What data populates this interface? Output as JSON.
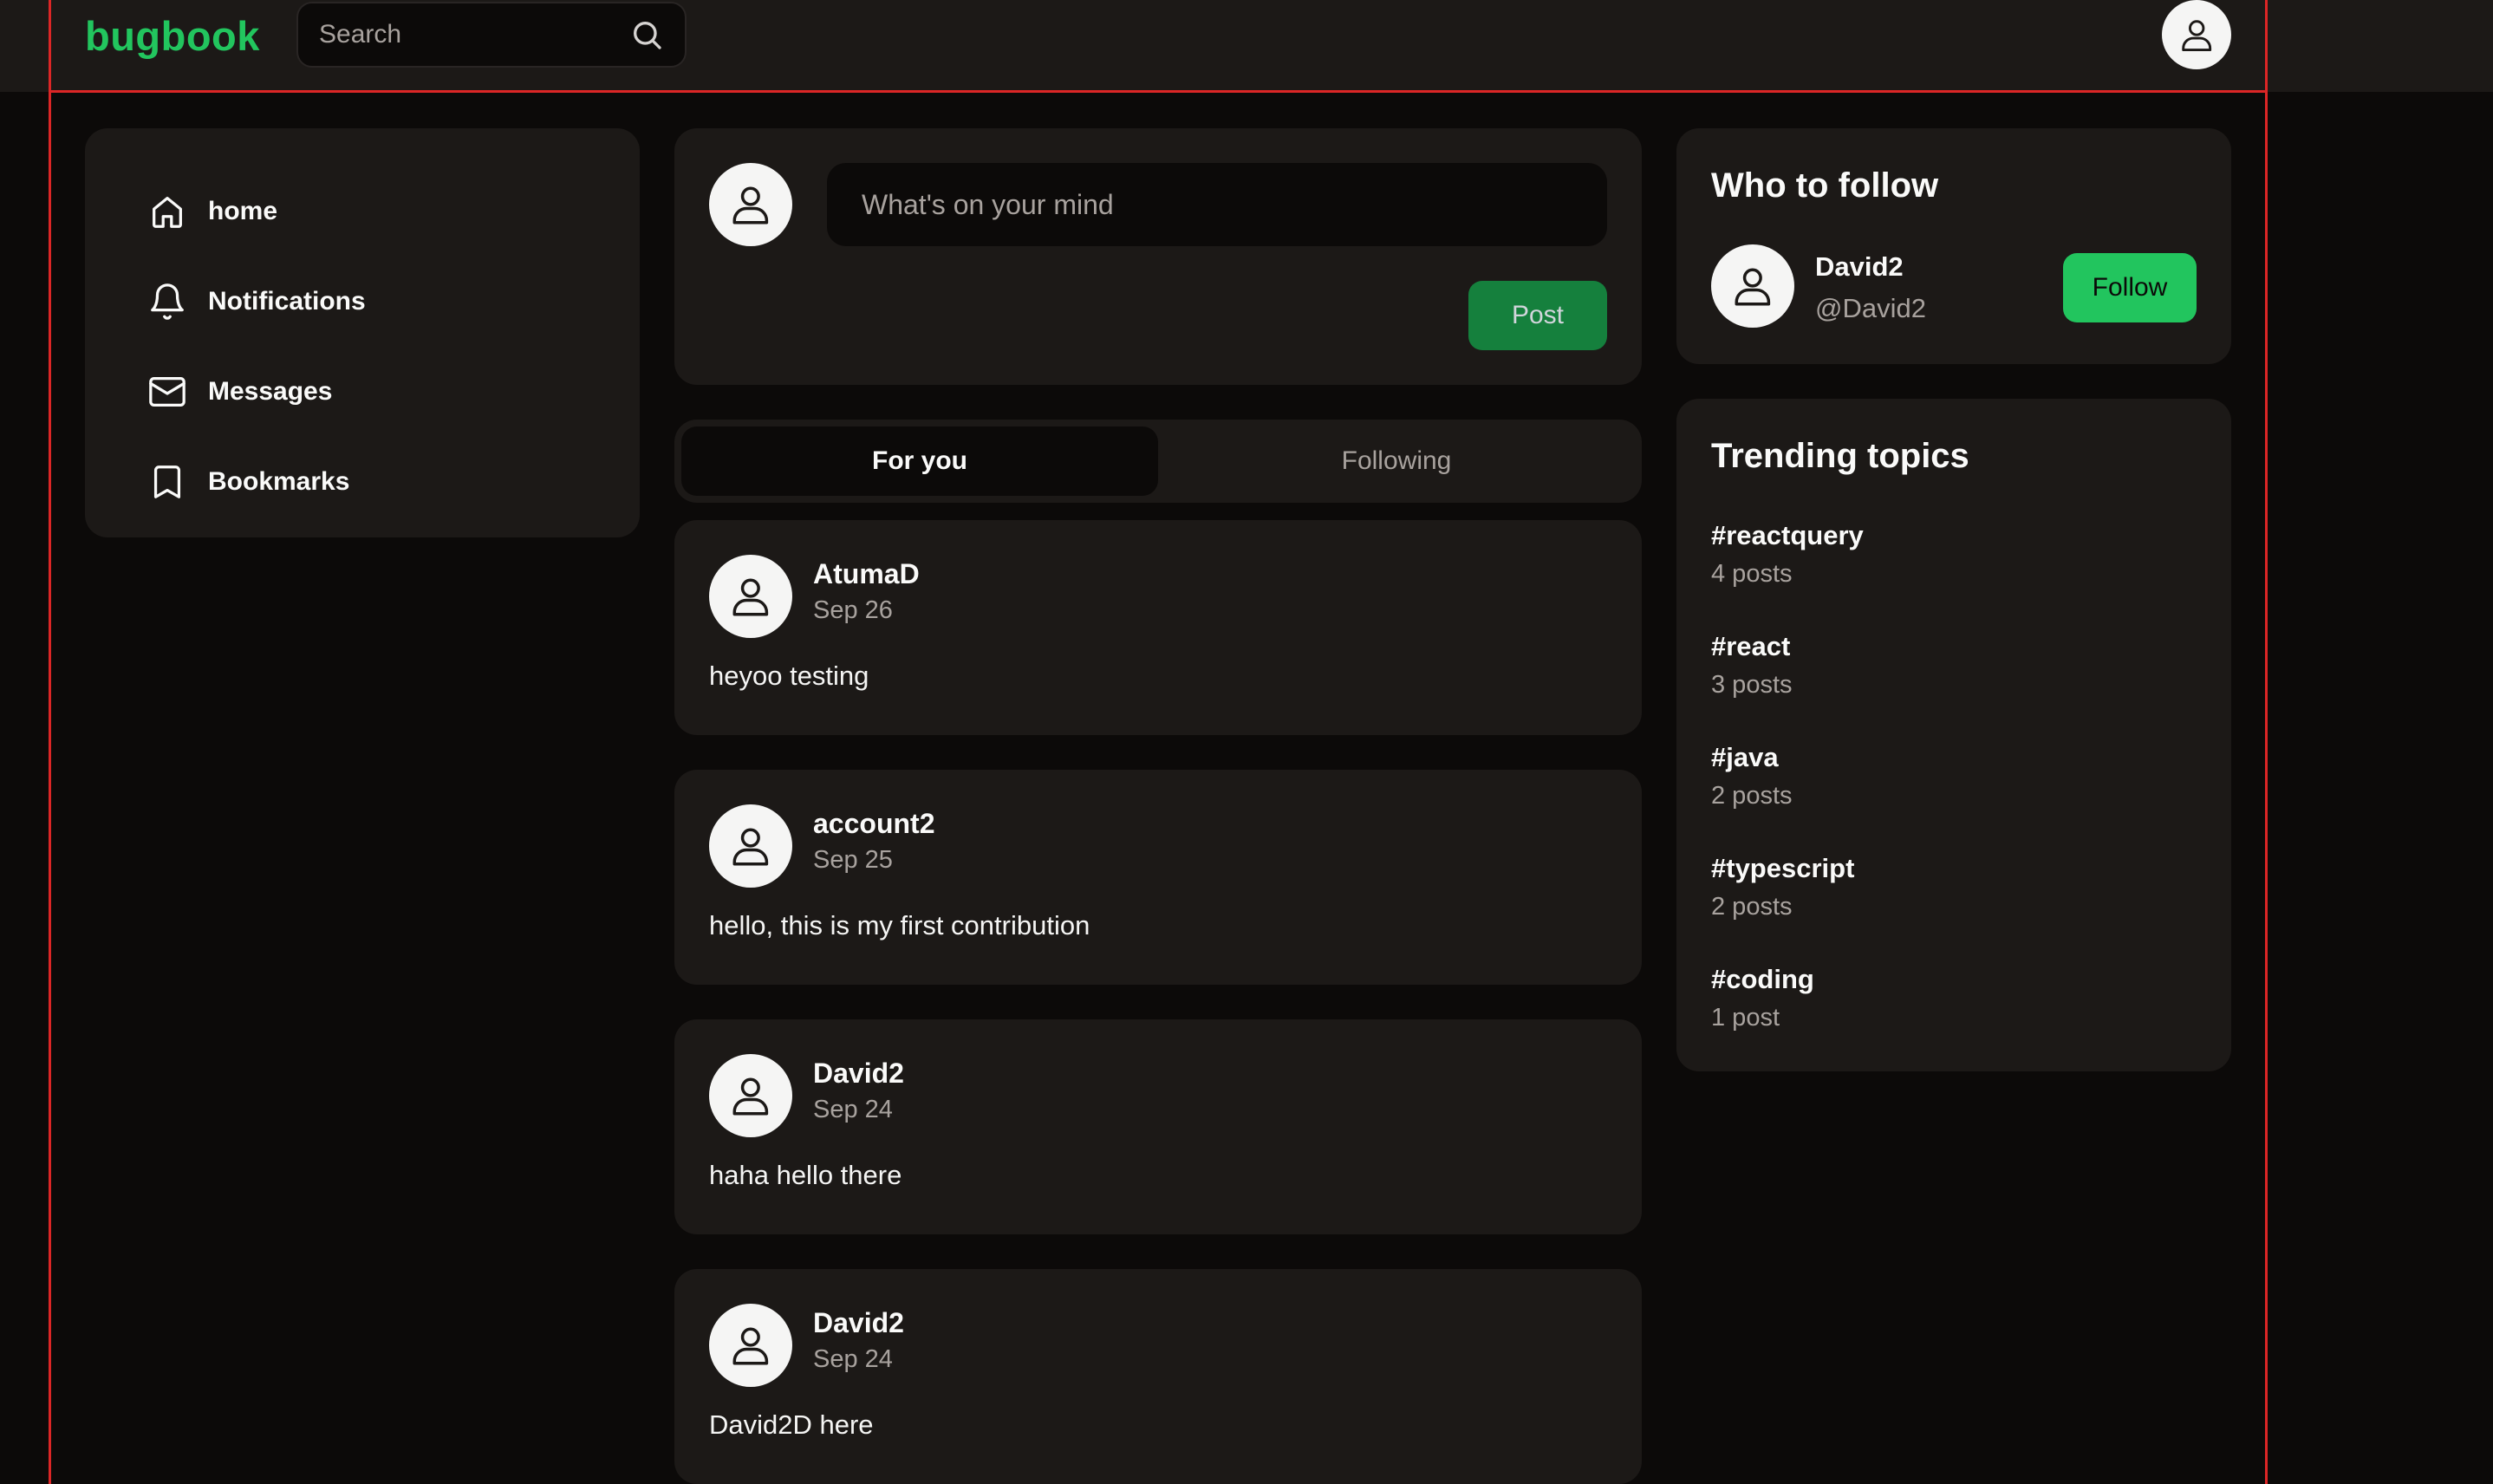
{
  "header": {
    "logo": "bugbook",
    "search_placeholder": "Search"
  },
  "sidebar": {
    "items": [
      {
        "label": "home",
        "icon": "home-icon"
      },
      {
        "label": "Notifications",
        "icon": "bell-icon"
      },
      {
        "label": "Messages",
        "icon": "mail-icon"
      },
      {
        "label": "Bookmarks",
        "icon": "bookmark-icon"
      }
    ]
  },
  "composer": {
    "placeholder": "What's on your mind",
    "post_label": "Post"
  },
  "tabs": [
    {
      "label": "For you",
      "active": true
    },
    {
      "label": "Following",
      "active": false
    }
  ],
  "posts": [
    {
      "author": "AtumaD",
      "date": "Sep 26",
      "content": "heyoo testing"
    },
    {
      "author": "account2",
      "date": "Sep 25",
      "content": "hello, this is my first contribution"
    },
    {
      "author": "David2",
      "date": "Sep 24",
      "content": "haha hello there"
    },
    {
      "author": "David2",
      "date": "Sep 24",
      "content": "David2D here"
    }
  ],
  "who_to_follow": {
    "title": "Who to follow",
    "users": [
      {
        "name": "David2",
        "handle": "@David2",
        "button": "Follow"
      }
    ]
  },
  "trending": {
    "title": "Trending topics",
    "topics": [
      {
        "tag": "#reactquery",
        "count": "4 posts"
      },
      {
        "tag": "#react",
        "count": "3 posts"
      },
      {
        "tag": "#java",
        "count": "2 posts"
      },
      {
        "tag": "#typescript",
        "count": "2 posts"
      },
      {
        "tag": "#coding",
        "count": "1 post"
      }
    ]
  },
  "colors": {
    "background": "#0c0a09",
    "card": "#1c1917",
    "accent": "#22c55e",
    "post_button": "#15803d",
    "frame_outline": "#dc2626"
  }
}
